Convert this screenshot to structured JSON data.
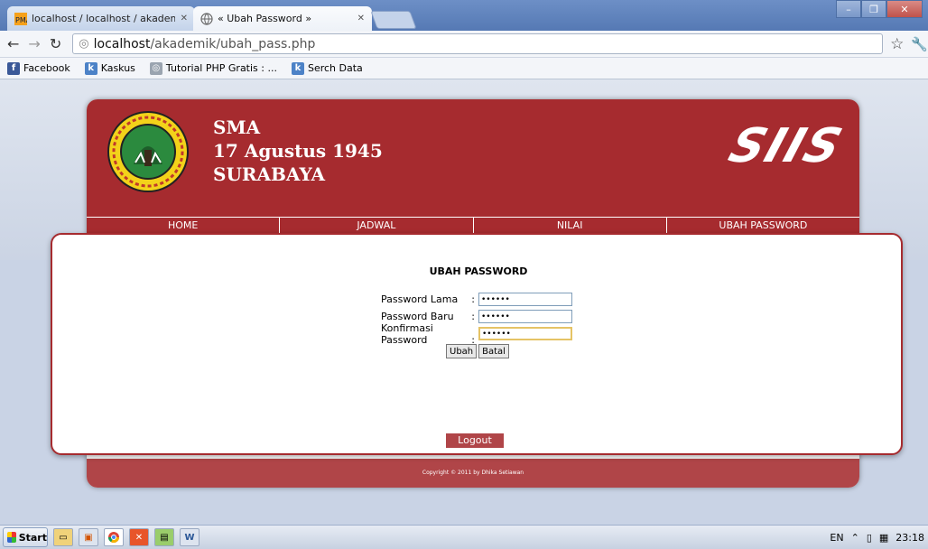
{
  "browser": {
    "tabs": [
      {
        "title": "localhost / localhost / akademik",
        "active": false
      },
      {
        "title": "« Ubah Password »",
        "active": true
      }
    ],
    "window_controls": {
      "minimize": "–",
      "maximize": "❐",
      "close": "✕"
    },
    "url": {
      "host": "localhost",
      "path": "/akademik/ubah_pass.php"
    },
    "bookmarks": [
      {
        "label": "Facebook",
        "icon": "facebook-icon",
        "color": "#3b5998"
      },
      {
        "label": "Kaskus",
        "icon": "kaskus-icon",
        "color": "#4c82c7"
      },
      {
        "label": "Tutorial PHP Gratis : ...",
        "icon": "globe-icon",
        "color": "#9aa4b0"
      },
      {
        "label": "Serch Data",
        "icon": "kaskus-icon",
        "color": "#4c82c7"
      }
    ]
  },
  "site": {
    "school": [
      "SMA",
      "17 Agustus 1945",
      "SURABAYA"
    ],
    "brand": "SIIS",
    "menu": [
      "HOME",
      "JADWAL",
      "NILAI",
      "UBAH PASSWORD"
    ],
    "colors": {
      "primary": "#a62b2f"
    },
    "form": {
      "title": "UBAH PASSWORD",
      "fields": [
        {
          "label": "Password Lama",
          "value": "••••••"
        },
        {
          "label": "Password Baru",
          "value": "••••••"
        },
        {
          "label": "Konfirmasi Password",
          "value": "••••••"
        }
      ],
      "submit": "Ubah",
      "cancel": "Batal"
    },
    "logout": "Logout",
    "footer": "Copyright © 2011 by Dhika Setiawan"
  },
  "taskbar": {
    "start": "Start",
    "language": "EN",
    "time": "23:18"
  }
}
